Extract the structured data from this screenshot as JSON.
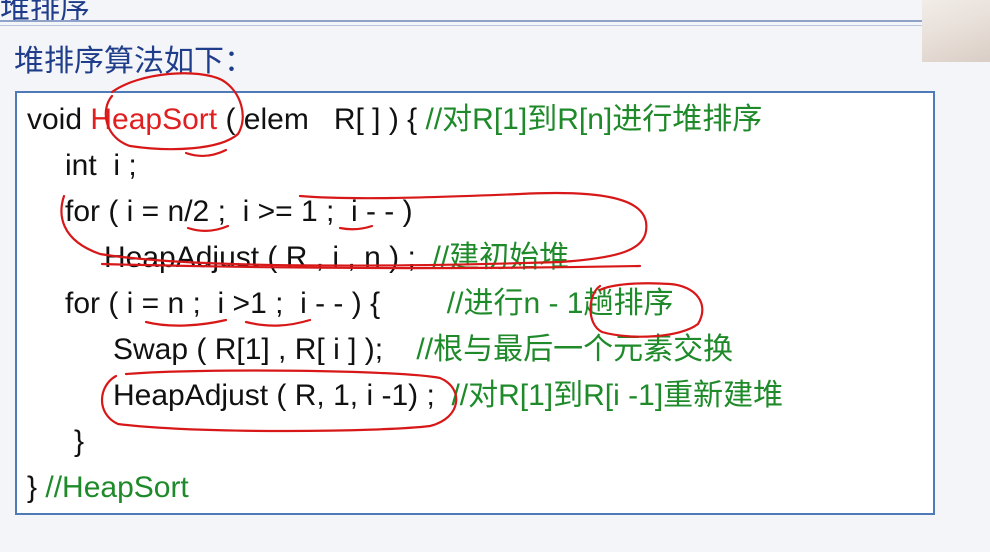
{
  "header": {
    "title": "堆排序",
    "subtitle": "堆排序算法如下："
  },
  "code": {
    "l1": {
      "a": "void ",
      "fn": "HeapSort",
      "b": " ( elem   R[ ] ) { ",
      "c": "//对R[1]到R[n]进行堆排序"
    },
    "l2": {
      "a": "int  i ;"
    },
    "l3": {
      "a": "for ( i = n/2 ;  i >= 1 ;  i - - )"
    },
    "l4": {
      "a": "HeapAdjust ( R , i , n ) ;  ",
      "c": "//建初始堆"
    },
    "l5": {
      "a": "for ( i = n ;  i >1 ;  i - - ) {        ",
      "c": "//进行n - 1趟排序"
    },
    "l6": {
      "a": "Swap ( R[1] , R[ i ] );    ",
      "c": "//根与最后一个元素交换"
    },
    "l7": {
      "a": "HeapAdjust ( R, 1, i -1) ;  ",
      "c": "//对R[1]到R[i -1]重新建堆"
    },
    "l8": {
      "a": "}"
    },
    "l9": {
      "a": "} ",
      "c": "//HeapSort"
    }
  },
  "colors": {
    "title": "#1f3d8a",
    "comment": "#1e8a2a",
    "highlight": "#e02020",
    "annotation": "#d81818",
    "box_border": "#4e7ab8"
  }
}
